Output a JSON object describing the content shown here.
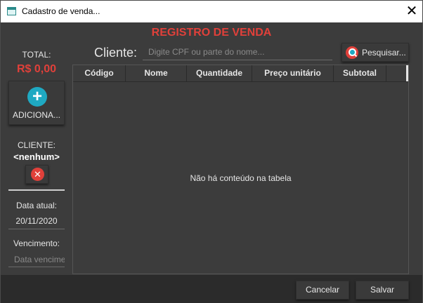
{
  "window": {
    "title": "Cadastro de venda..."
  },
  "main_title": "REGISTRO DE VENDA",
  "sidebar": {
    "total_label": "TOTAL:",
    "total_value": "R$ 0,00",
    "add_button_label": "ADICIONA...",
    "client_label": "CLIENTE:",
    "client_value": "<nenhum>",
    "date_label": "Data atual:",
    "date_value": "20/11/2020",
    "due_label": "Vencimento:",
    "due_placeholder": "Data vencimento"
  },
  "search": {
    "label": "Cliente:",
    "placeholder": "Digite CPF ou parte do nome...",
    "button_label": "Pesquisar..."
  },
  "table": {
    "columns": [
      "Código",
      "Nome",
      "Quantidade",
      "Preço unitário",
      "Subtotal"
    ],
    "rows": [],
    "empty_message": "Não há conteúdo na tabela"
  },
  "footer": {
    "cancel_label": "Cancelar",
    "save_label": "Salvar"
  },
  "colors": {
    "accent_red": "#e0403a",
    "accent_cyan": "#1fa9c2",
    "background": "#3c3c3c"
  }
}
